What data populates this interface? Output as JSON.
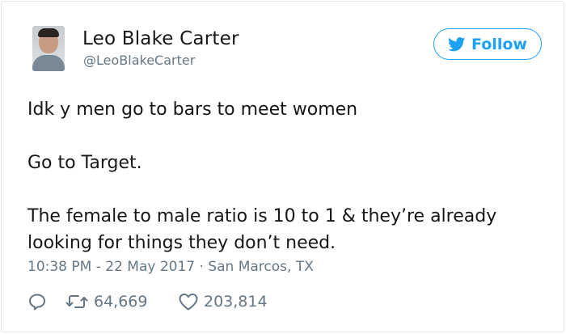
{
  "author": {
    "name": "Leo Blake Carter",
    "handle": "@LeoBlakeCarter"
  },
  "follow_button": {
    "label": "Follow",
    "icon": "twitter-bird-icon",
    "color": "#1da1f2"
  },
  "tweet": {
    "paragraphs": [
      "Idk y men go to bars to meet women",
      "Go to Target.",
      "The female to male ratio is 10 to 1 & they’re already looking for things they don’t need."
    ],
    "meta": "10:38 PM - 22 May 2017 · San Marcos, TX"
  },
  "actions": {
    "reply": {
      "icon": "reply-icon"
    },
    "retweet": {
      "icon": "retweet-icon",
      "count": "64,669"
    },
    "like": {
      "icon": "heart-icon",
      "count": "203,814"
    }
  },
  "colors": {
    "text": "#14171a",
    "secondary": "#657786",
    "border": "#e1e8ed"
  }
}
